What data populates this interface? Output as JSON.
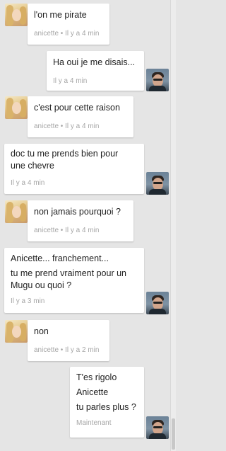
{
  "conversation": {
    "messages": [
      {
        "sender": "anicette",
        "lines": [
          "l'on me pirate"
        ],
        "meta": "anicette • Il y a 4 min"
      },
      {
        "sender": "me",
        "lines": [
          "Ha oui je me disais..."
        ],
        "meta": "Il y a 4 min"
      },
      {
        "sender": "anicette",
        "lines": [
          "c'est pour cette raison"
        ],
        "meta": "anicette • Il y a 4 min"
      },
      {
        "sender": "me",
        "lines": [
          "doc tu me prends bien pour",
          "une chevre"
        ],
        "meta": "Il y a 4 min"
      },
      {
        "sender": "anicette",
        "lines": [
          "non jamais pourquoi ?"
        ],
        "meta": "anicette • Il y a 4 min"
      },
      {
        "sender": "me",
        "lines": [
          "Anicette... franchement...",
          "tu me prend vraiment pour un",
          "Mugu ou quoi ?"
        ],
        "meta": "Il y a 3 min"
      },
      {
        "sender": "anicette",
        "lines": [
          "non"
        ],
        "meta": "anicette • Il y a 2 min"
      },
      {
        "sender": "me",
        "lines": [
          "T'es rigolo",
          "Anicette",
          "tu parles plus ?"
        ],
        "meta": "Maintenant"
      }
    ]
  },
  "icons": {
    "anicette_avatar": "anicette-avatar",
    "user_avatar": "user-avatar"
  },
  "colors": {
    "background": "#e5e5e5",
    "bubble": "#ffffff",
    "text": "#222222",
    "meta": "#a6a6a6"
  }
}
